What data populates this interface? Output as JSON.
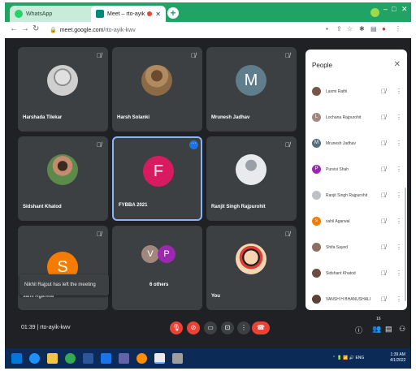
{
  "browser": {
    "tabs": [
      {
        "label": "WhatsApp",
        "icon": "whatsapp-icon"
      },
      {
        "label": "Meet – rto-ayik-kwv",
        "icon": "meet-icon"
      }
    ],
    "url_host": "meet.google.com",
    "url_path": "/rto-ayik-kwv",
    "tab_strip_color": "#21a366"
  },
  "meet": {
    "tiles": [
      {
        "name": "Harshada Tilekar",
        "type": "photo",
        "color": "#c9c9c9"
      },
      {
        "name": "Harsh Solanki",
        "type": "photo",
        "color": "#a07850"
      },
      {
        "name": "Mrunesh Jadhav",
        "type": "letter",
        "letter": "M",
        "color": "#607d8b"
      },
      {
        "name": "Sidshant Khatod",
        "type": "photo",
        "color": "#6a8a5a"
      },
      {
        "name": "FYBBA 2021",
        "type": "letter",
        "letter": "F",
        "color": "#d81b60"
      },
      {
        "name": "Ranjit Singh Rajpurohit",
        "type": "photo",
        "color": "#e8eaed"
      },
      {
        "name": "sahil Agarwal",
        "type": "letter",
        "letter": "S",
        "color": "#f57c00"
      },
      {
        "name": "6 others",
        "type": "group",
        "letters": [
          "V",
          "P"
        ],
        "colors": [
          "#a1887f",
          "#9c27b0"
        ]
      },
      {
        "name": "You",
        "type": "photo",
        "color": "#f2d7b0"
      }
    ],
    "toast": "Nikhil Rajput has left the meeting",
    "time": "01:39",
    "meeting_code": "rto-ayik-kwv",
    "participant_count": "16"
  },
  "people_panel": {
    "title": "People",
    "people": [
      {
        "name": "Laxmi Rathi",
        "color": "#795548",
        "letter": ""
      },
      {
        "name": "Lochana Rajpurohit",
        "color": "#a1887f",
        "letter": "L"
      },
      {
        "name": "Mrunesh Jadhav",
        "color": "#546e7a",
        "letter": "M"
      },
      {
        "name": "Purvisi Shah",
        "color": "#9c27b0",
        "letter": "P"
      },
      {
        "name": "Ranjit Singh Rajpurohit",
        "color": "#bdc1c6",
        "letter": ""
      },
      {
        "name": "sahil Agarwal",
        "color": "#f57c00",
        "letter": "s"
      },
      {
        "name": "Shifa Sayed",
        "color": "#8d6e63",
        "letter": ""
      },
      {
        "name": "Sidshant Khatod",
        "color": "#6d4c41",
        "letter": ""
      },
      {
        "name": "VANSH H BHANUSHALI",
        "color": "#5d4037",
        "letter": ""
      }
    ]
  },
  "taskbar": {
    "time": "1:39 AM",
    "date": "4/1/2022",
    "lang": "ENG"
  }
}
